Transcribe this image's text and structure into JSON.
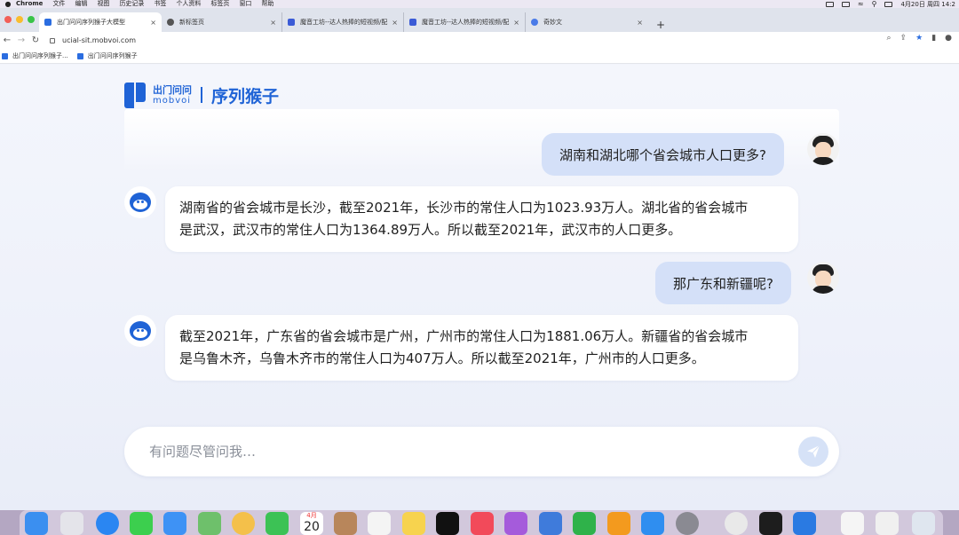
{
  "menubar": {
    "app": "Chrome",
    "items": [
      "文件",
      "编辑",
      "视图",
      "历史记录",
      "书签",
      "个人资料",
      "标签页",
      "窗口",
      "帮助"
    ],
    "clock": "4月20日 周四 14:2"
  },
  "tabs": [
    {
      "label": "出门问问序列猴子大模型",
      "active": true,
      "favicon_color": "#2b6de0"
    },
    {
      "label": "新标签页",
      "active": false,
      "favicon_color": "#555555"
    },
    {
      "label": "魔音工坊--达人热捧的短视频/配",
      "active": false,
      "favicon_color": "#3b5bd6"
    },
    {
      "label": "魔音工坊--达人热捧的短视频/配",
      "active": false,
      "favicon_color": "#3b5bd6"
    },
    {
      "label": "奇妙文",
      "active": false,
      "favicon_color": "#4a7be8"
    }
  ],
  "address": {
    "url": "ucial-sit.mobvoi.com"
  },
  "bookmarks": [
    "出门问问序列猴子...",
    "出门问问序列猴子"
  ],
  "logo": {
    "cn": "出门问问",
    "en": "mobvoi",
    "product": "序列猴子"
  },
  "conversation": [
    {
      "role": "user",
      "text": "湖南和湖北哪个省会城市人口更多?"
    },
    {
      "role": "bot",
      "lines": [
        "湖南省的省会城市是长沙，截至2021年，长沙市的常住人口为1023.93万人。湖北省的省会城市",
        "是武汉，武汉市的常住人口为1364.89万人。所以截至2021年，武汉市的人口更多。"
      ]
    },
    {
      "role": "user",
      "text": "那广东和新疆呢?"
    },
    {
      "role": "bot",
      "lines": [
        "截至2021年，广东省的省会城市是广州，广州市的常住人口为1881.06万人。新疆省的省会城市",
        "是乌鲁木齐，乌鲁木齐市的常住人口为407万人。所以截至2021年，广州市的人口更多。"
      ]
    }
  ],
  "input": {
    "placeholder": "有问题尽管问我…"
  },
  "calendar": {
    "month": "4月",
    "day": "20"
  },
  "colors": {
    "brand": "#1f63d6",
    "user_bubble": "#d4e0f8",
    "bot_bubble": "#ffffff"
  }
}
